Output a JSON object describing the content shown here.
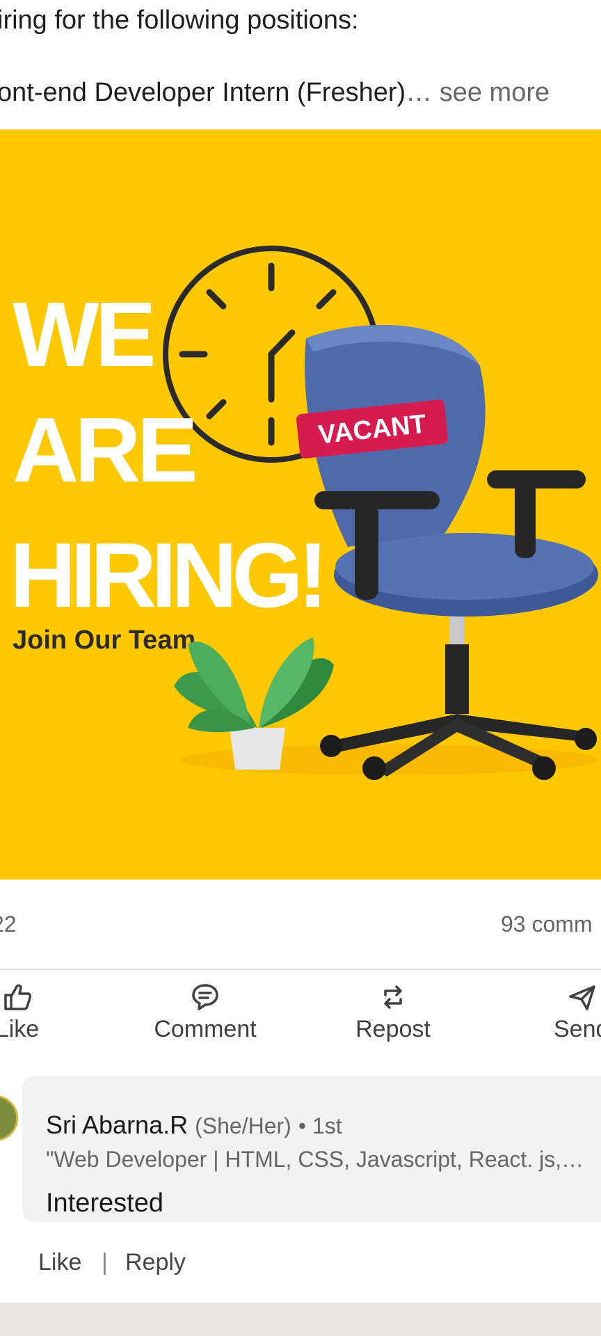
{
  "post": {
    "line1": "iring for the following positions:",
    "line2": "ont-end Developer Intern (Fresher)",
    "ellipsis": "…",
    "see_more": "see more"
  },
  "image": {
    "headline_1": "WE",
    "headline_2": "ARE",
    "headline_3": "HIRING!",
    "tagline": "Join Our Team",
    "sign": "VACANT",
    "bg_color": "#ffc800",
    "chair_color": "#4f6aab",
    "sign_color": "#d81b4f"
  },
  "stats": {
    "reactions": "22",
    "comments": "93 comm"
  },
  "actions": [
    {
      "label": "Like",
      "icon": "thumbs-up-icon"
    },
    {
      "label": "Comment",
      "icon": "comment-icon"
    },
    {
      "label": "Repost",
      "icon": "repost-icon"
    },
    {
      "label": "Send",
      "icon": "send-icon"
    }
  ],
  "comment": {
    "author": "Sri Abarna.R",
    "pronouns": "(She/Her)",
    "degree": "• 1st",
    "headline": "\"Web Developer | HTML, CSS, Javascript, React. js,…",
    "text": "Interested",
    "like_label": "Like",
    "separator": "|",
    "reply_label": "Reply"
  }
}
